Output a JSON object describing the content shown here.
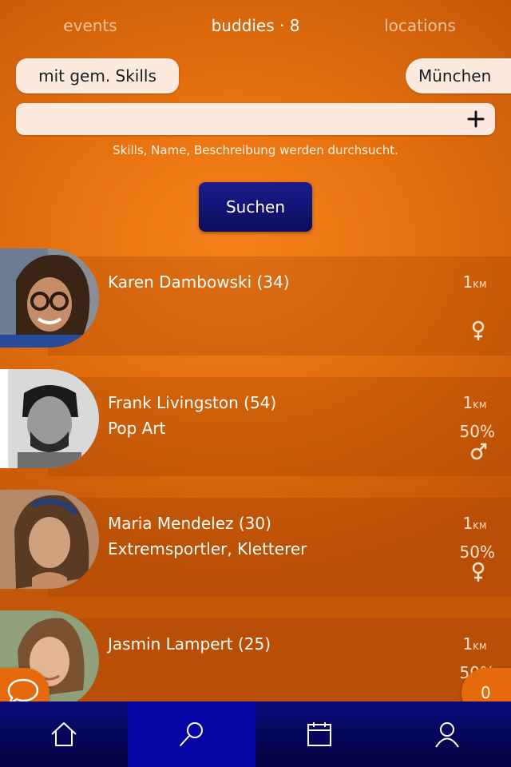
{
  "tabs": [
    {
      "label": "events"
    },
    {
      "label": "buddies · 8"
    },
    {
      "label": "locations"
    }
  ],
  "filters": {
    "skills_chip": "mit gem. Skills",
    "city_chip": "München"
  },
  "search": {
    "value": "",
    "placeholder": "",
    "hint": "Skills, Name, Beschreibung werden durchsucht.",
    "button_label": "Suchen"
  },
  "buddies": [
    {
      "name": "Karen Dambowski (34)",
      "skills": "",
      "distance": "1",
      "distance_unit": "KM",
      "match": "",
      "gender": "female"
    },
    {
      "name": "Frank Livingston (54)",
      "skills": "Pop Art",
      "distance": "1",
      "distance_unit": "KM",
      "match": "50%",
      "gender": "male"
    },
    {
      "name": "Maria Mendelez (30)",
      "skills": "Extremsportler, Kletterer",
      "distance": "1",
      "distance_unit": "KM",
      "match": "50%",
      "gender": "female"
    },
    {
      "name": "Jasmin Lampert (25)",
      "skills": "",
      "distance": "1",
      "distance_unit": "KM",
      "match": "50%",
      "gender": "female"
    }
  ],
  "notification_count": "0",
  "nav": [
    {
      "icon": "home-icon"
    },
    {
      "icon": "search-icon"
    },
    {
      "icon": "calendar-icon"
    },
    {
      "icon": "user-icon"
    }
  ],
  "colors": {
    "background": "#f07a14",
    "accent_blue": "#0b0c7a",
    "chip": "#fbeadd"
  }
}
